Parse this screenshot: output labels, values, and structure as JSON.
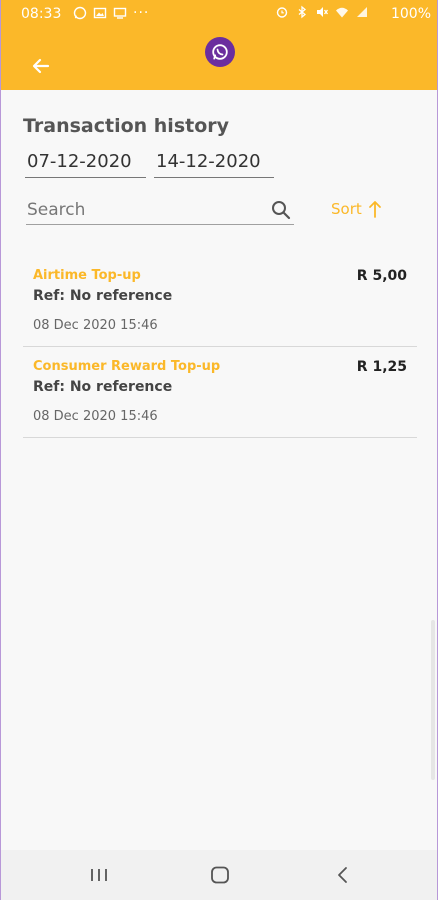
{
  "status_bar": {
    "time": "08:33",
    "battery": "100%",
    "icons_left": [
      "whatsapp-icon",
      "image-icon",
      "monitor-icon"
    ],
    "icons_right": [
      "alarm-icon",
      "bluetooth-icon",
      "mute-icon",
      "wifi-icon",
      "signal-icon"
    ]
  },
  "header": {
    "back_icon": "arrow-left-icon",
    "logo_icon": "whatsapp-icon",
    "accent_color": "#fbb829"
  },
  "page": {
    "title": "Transaction history"
  },
  "filters": {
    "date_from": "07-12-2020",
    "date_to": "14-12-2020",
    "search_placeholder": "Search",
    "search_value": "",
    "sort_label": "Sort",
    "sort_icon": "arrow-up-icon"
  },
  "transactions": [
    {
      "name": "Airtime Top-up",
      "ref": "Ref: No reference",
      "date": "08 Dec 2020 15:46",
      "amount": "R 5,00"
    },
    {
      "name": "Consumer Reward Top-up",
      "ref": "Ref: No reference",
      "date": "08 Dec 2020 15:46",
      "amount": "R 1,25"
    }
  ],
  "nav_bar": {
    "buttons": [
      "recent-apps-icon",
      "home-icon",
      "back-icon"
    ]
  }
}
